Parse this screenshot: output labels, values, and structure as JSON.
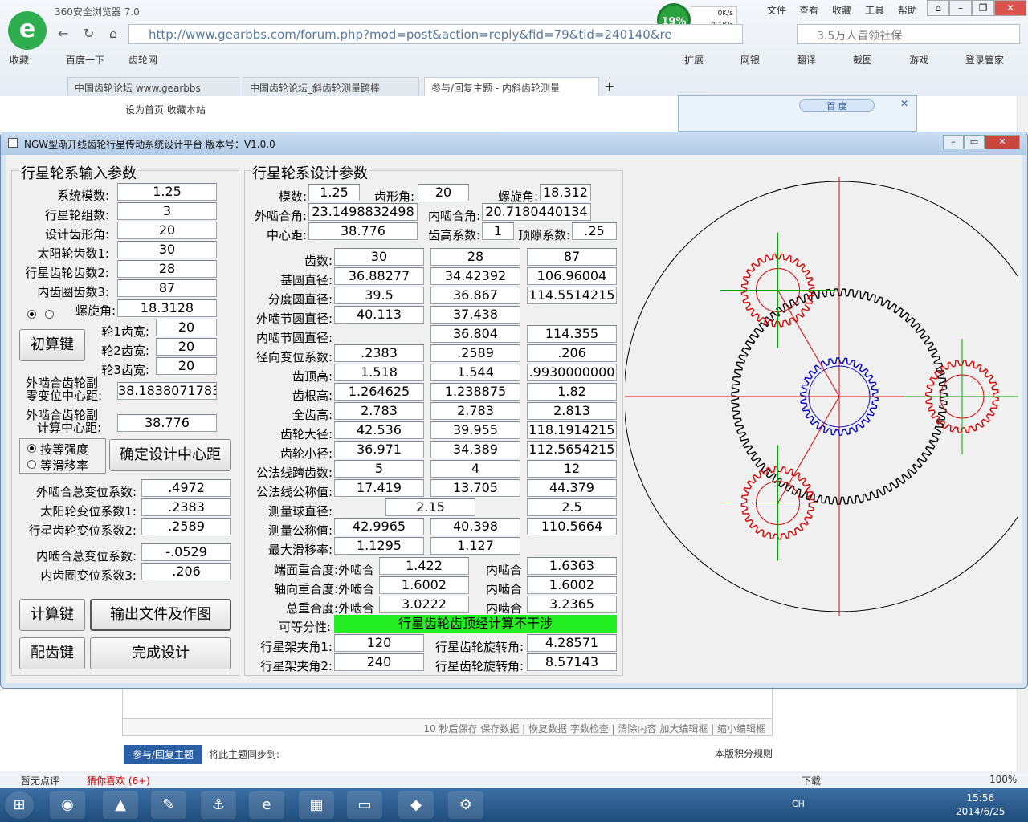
{
  "browser": {
    "title": "360安全浏览器 7.0",
    "logo": "e",
    "speed_pct": "19%",
    "speed_up": "0K/s",
    "speed_down": "0.1K/s",
    "menu": [
      "文件",
      "查看",
      "收藏",
      "工具",
      "帮助"
    ],
    "url": "http://www.gearbbs.com/forum.php?mod=post&action=reply&fid=79&tid=240140&re",
    "search": "3.5万人冒领社保",
    "bookmarks": [
      "收藏",
      "百度一下",
      "齿轮网"
    ],
    "tools": [
      "扩展",
      "网银",
      "翻译",
      "截图",
      "游戏",
      "登录管家"
    ],
    "tabs": [
      "中国齿轮论坛 www.gearbbs",
      "中国齿轮论坛_斜齿轮测量跨棒",
      "参与/回复主题 - 内斜齿轮测量"
    ],
    "page_links": "设为首页  收藏本站",
    "baidu": "百 度",
    "editor_tools": "10 秒后保存  保存数据 | 恢复数据    字数检查 | 清除内容    加大编辑框 | 缩小编辑框",
    "reply_btn": "参与/回复主题",
    "sync": "将此主题同步到:",
    "rules": "本版积分规则",
    "status_left": "暂无点评",
    "status_like": "猜你喜欢 (6+)",
    "status_dl": "下载",
    "status_zoom": "100%",
    "clock_time": "15:56",
    "clock_date": "2014/6/25",
    "lang": "CH"
  },
  "app": {
    "title": "NGW型渐开线齿轮行星传动系统设计平台  版本号：V1.0.0"
  },
  "input": {
    "title": "行星轮系输入参数",
    "rows": [
      {
        "label": "系统模数:",
        "value": "1.25"
      },
      {
        "label": "行星轮组数:",
        "value": "3"
      },
      {
        "label": "设计齿形角:",
        "value": "20"
      },
      {
        "label": "太阳轮齿数1:",
        "value": "30"
      },
      {
        "label": "行星齿轮齿数2:",
        "value": "28"
      },
      {
        "label": "内齿圈齿数3:",
        "value": "87"
      }
    ],
    "helix_label": "螺旋角:",
    "helix_value": "18.3128",
    "calc_btn": "初算键",
    "width_rows": [
      {
        "label": "轮1齿宽:",
        "value": "20"
      },
      {
        "label": "轮2齿宽:",
        "value": "20"
      },
      {
        "label": "轮3齿宽:",
        "value": "20"
      }
    ],
    "ext_zero_label1": "外啮合齿轮副",
    "ext_zero_label2": "零变位中心距:",
    "ext_zero_value": "38.1838071783",
    "ext_calc_label1": "外啮合齿轮副",
    "ext_calc_label2": "计算中心距:",
    "ext_calc_value": "38.776",
    "radio1": "按等强度",
    "radio2": "等滑移率",
    "confirm_btn": "确定设计中心距",
    "shift_rows": [
      {
        "label": "外啮合总变位系数:",
        "value": ".4972"
      },
      {
        "label": "太阳轮变位系数1:",
        "value": ".2383"
      },
      {
        "label": "行星齿轮变位系数2:",
        "value": ".2589"
      }
    ],
    "int_rows": [
      {
        "label": "内啮合总变位系数:",
        "value": "-.0529"
      },
      {
        "label": "内齿圈变位系数3:",
        "value": ".206"
      }
    ],
    "btn_calc": "计算键",
    "btn_output": "输出文件及作图",
    "btn_match": "配齿键",
    "btn_finish": "完成设计"
  },
  "design": {
    "title": "行星轮系设计参数",
    "module_label": "模数:",
    "module": "1.25",
    "pa_label": "齿形角:",
    "pa": "20",
    "helix_label": "螺旋角:",
    "helix": "18.312",
    "ext_angle_label": "外啮合角:",
    "ext_angle": "23.1498832498",
    "int_angle_label": "内啮合角:",
    "int_angle": "20.7180440134",
    "cd_label": "中心距:",
    "cd": "38.776",
    "ha_label": "齿高系数:",
    "ha": "1",
    "c_label": "顶隙系数:",
    "c": ".25",
    "rows": [
      {
        "label": "齿数:",
        "v": [
          "30",
          "28",
          "87"
        ]
      },
      {
        "label": "基圆直径:",
        "v": [
          "36.88277",
          "34.42392",
          "106.96004"
        ]
      },
      {
        "label": "分度圆直径:",
        "v": [
          "39.5",
          "36.867",
          "114.5514215"
        ]
      },
      {
        "label": "外啮节圆直径:",
        "v": [
          "40.113",
          "37.438",
          ""
        ]
      },
      {
        "label": "内啮节圆直径:",
        "v": [
          "",
          "36.804",
          "114.355"
        ]
      },
      {
        "label": "径向变位系数:",
        "v": [
          ".2383",
          ".2589",
          ".206"
        ]
      },
      {
        "label": "齿顶高:",
        "v": [
          "1.518",
          "1.544",
          ".9930000000"
        ]
      },
      {
        "label": "齿根高:",
        "v": [
          "1.264625",
          "1.238875",
          "1.82"
        ]
      },
      {
        "label": "全齿高:",
        "v": [
          "2.783",
          "2.783",
          "2.813"
        ]
      },
      {
        "label": "齿轮大径:",
        "v": [
          "42.536",
          "39.955",
          "118.1914215"
        ]
      },
      {
        "label": "齿轮小径:",
        "v": [
          "36.971",
          "34.389",
          "112.5654215"
        ]
      },
      {
        "label": "公法线跨齿数:",
        "v": [
          "5",
          "4",
          "12"
        ]
      },
      {
        "label": "公法线公称值:",
        "v": [
          "17.419",
          "13.705",
          "44.379"
        ]
      }
    ],
    "ball_label": "测量球直径:",
    "ball_ext": "2.15",
    "ball_int": "2.5",
    "meas_label": "测量公称值:",
    "meas": [
      "42.9965",
      "40.398",
      "110.5664"
    ],
    "slide_label": "最大滑移率:",
    "slide": [
      "1.1295",
      "1.127"
    ],
    "contact": [
      {
        "label": "端面重合度:外啮合",
        "ext": "1.422",
        "int_label": "内啮合",
        "int": "1.6363"
      },
      {
        "label": "轴向重合度:外啮合",
        "ext": "1.6002",
        "int_label": "内啮合",
        "int": "1.6002"
      },
      {
        "label": "总重合度:外啮合",
        "ext": "3.0222",
        "int_label": "内啮合",
        "int": "3.2365"
      }
    ],
    "equal_label": "可等分性:",
    "equal_value": "行星齿轮齿顶经计算不干涉",
    "carrier": [
      {
        "label": "行星架夹角1:",
        "value": "120",
        "rot_label": "行星齿轮旋转角:",
        "rot": "4.28571"
      },
      {
        "label": "行星架夹角2:",
        "value": "240",
        "rot_label": "行星齿轮旋转角:",
        "rot": "8.57143"
      }
    ]
  },
  "drawing": {
    "sun_teeth": 30,
    "planet_teeth": 28,
    "ring_teeth": 87,
    "planet_angles_deg": [
      0,
      120,
      240
    ],
    "colors": {
      "ring": "#000000",
      "sun": "#0000cc",
      "planet": "#dd0000",
      "axis": "#dd0000",
      "planet_axis": "#00aa00",
      "success": "#22ee22"
    }
  }
}
